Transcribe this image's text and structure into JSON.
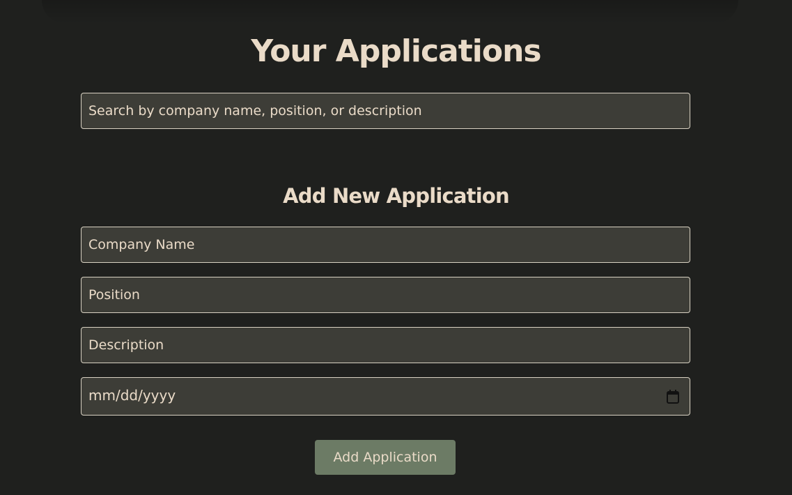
{
  "header": {
    "title": "Your Applications"
  },
  "search": {
    "placeholder": "Search by company name, position, or description"
  },
  "form": {
    "heading": "Add New Application",
    "company_placeholder": "Company Name",
    "position_placeholder": "Position",
    "description_placeholder": "Description",
    "date_placeholder": "mm/dd/yyyy",
    "date_icon": "calendar-icon",
    "submit_label": "Add Application"
  },
  "colors": {
    "background": "#1f201e",
    "text": "#eadbc8",
    "field_background": "#3d3d37",
    "field_border": "#d9d2c3",
    "button": "#6c7b65"
  }
}
